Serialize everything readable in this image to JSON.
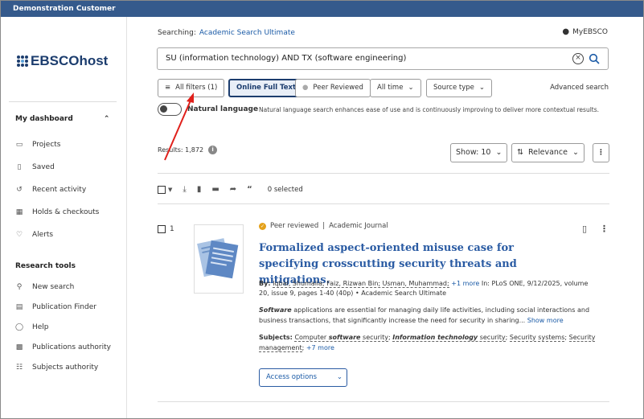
{
  "topbar": {
    "customer": "Demonstration Customer"
  },
  "logo": {
    "text": "EBSCOhost"
  },
  "sidebar": {
    "dashboard_heading": "My dashboard",
    "dashboard_items": [
      {
        "label": "Projects",
        "icon": "folder-icon"
      },
      {
        "label": "Saved",
        "icon": "bookmark-icon"
      },
      {
        "label": "Recent activity",
        "icon": "history-icon"
      },
      {
        "label": "Holds & checkouts",
        "icon": "library-icon"
      },
      {
        "label": "Alerts",
        "icon": "bell-icon"
      }
    ],
    "tools_heading": "Research tools",
    "tools_items": [
      {
        "label": "New search",
        "icon": "search-icon"
      },
      {
        "label": "Publication Finder",
        "icon": "document-icon"
      },
      {
        "label": "Help",
        "icon": "help-icon"
      },
      {
        "label": "Publications authority",
        "icon": "book-icon"
      },
      {
        "label": "Subjects authority",
        "icon": "hierarchy-icon"
      }
    ]
  },
  "header": {
    "searching_label": "Searching:",
    "database": "Academic Search Ultimate",
    "myebsco": "MyEBSCO"
  },
  "search": {
    "query": "SU (information technology) AND TX (software engineering)"
  },
  "filters": {
    "all_filters": "All filters (1)",
    "online_full_text": "Online Full Text",
    "peer_reviewed": "Peer Reviewed",
    "all_time": "All time",
    "source_type": "Source type",
    "advanced": "Advanced search"
  },
  "natural_language": {
    "label": "Natural language",
    "description": "Natural language search enhances ease of use and is continuously improving to deliver more contextual results."
  },
  "results": {
    "count_label": "Results: 1,872",
    "show": "Show: 10",
    "sort": "Relevance",
    "selected": "0 selected"
  },
  "result": {
    "index": "1",
    "peer_reviewed": "Peer reviewed",
    "separator": "|",
    "type": "Academic Journal",
    "title": "Formalized aspect-oriented misuse case for specifying crosscutting security threats and mitigations.",
    "by_label": "By:",
    "authors": "Iqbal, Shumaila; Faiz, Rizwan Bin; Usman, Muhammad;",
    "more_authors": "+1 more",
    "source": "In: PLoS ONE, 9/12/2025, volume 20, issue 9, pages 1-40 (40p) • Academic Search Ultimate",
    "abstract_bold": "Software",
    "abstract": " applications are essential for managing daily life activities, including social interactions and business transactions, that significantly increase the need for security in sharing...",
    "show_more": "Show more",
    "subjects_label": "Subjects:",
    "subjects": [
      {
        "pre": "Computer ",
        "bold": "software",
        "post": " security"
      },
      {
        "pre": "",
        "bold": "Information technology",
        "post": " security"
      },
      {
        "pre": "Security systems",
        "bold": "",
        "post": ""
      },
      {
        "pre": "Security management",
        "bold": "",
        "post": ""
      }
    ],
    "subjects_more": "+7 more",
    "access": "Access options"
  }
}
